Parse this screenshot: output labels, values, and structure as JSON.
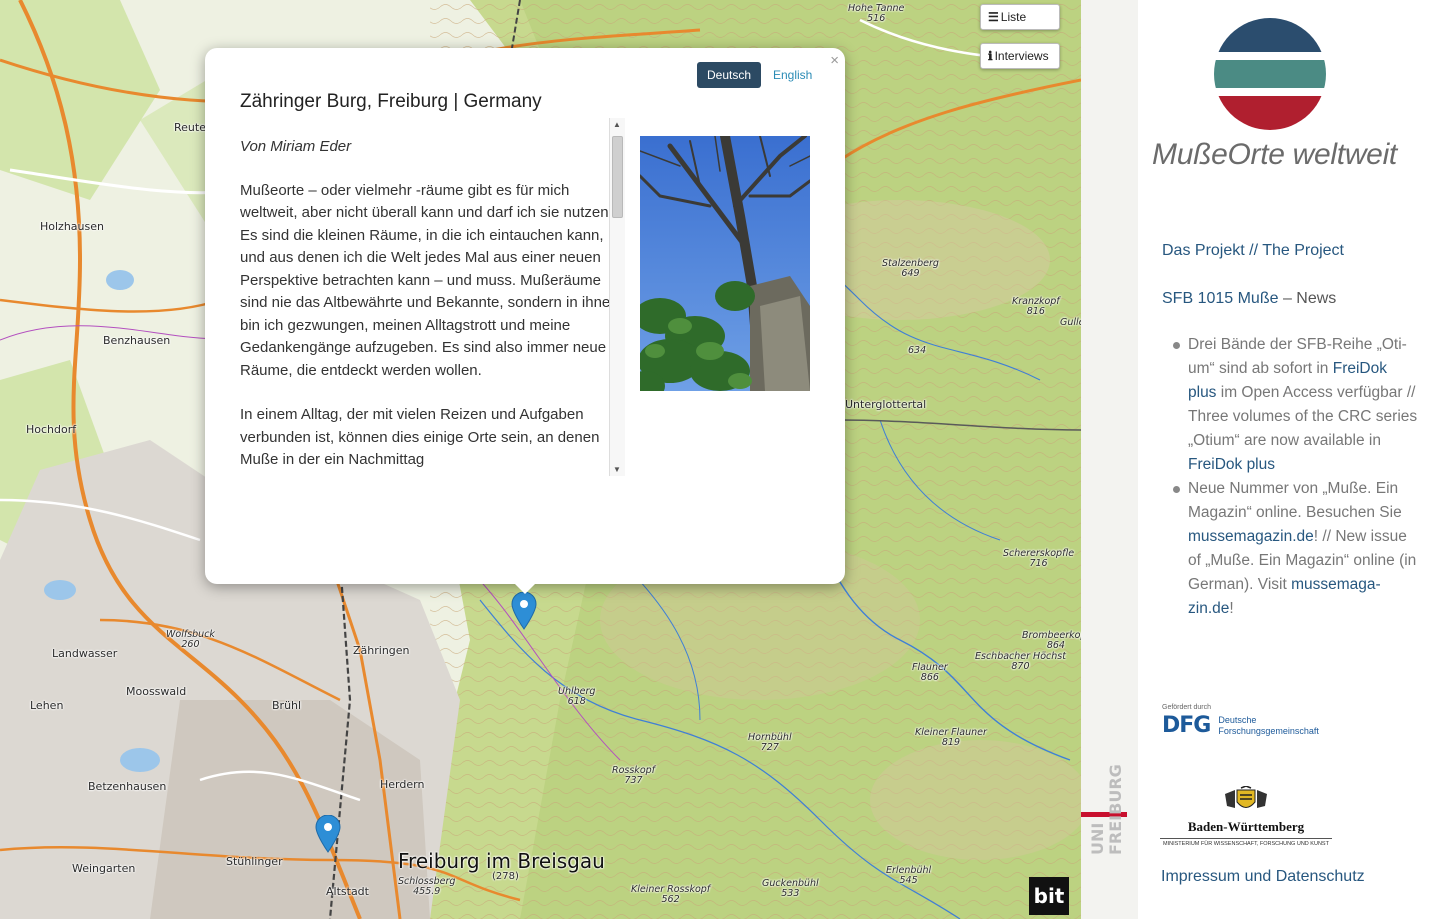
{
  "map": {
    "buttons": {
      "list_label": "Liste",
      "interviews_label": "Interviews",
      "list_icon": "list-icon",
      "interviews_icon": "info-icon"
    },
    "places": {
      "hohe_tanne": "Hohe Tanne",
      "hohe_tanne_alt": "516",
      "reute": "Reute",
      "holzhausen": "Holzhausen",
      "benzhausen": "Benzhausen",
      "hochdorf": "Hochdorf",
      "stalzenberg": "Stalzenberg",
      "stalzenberg_alt": "649",
      "kranzkopf": "Kranzkopf",
      "kranzkopf_alt": "816",
      "gullerkopf": "Gullerkopf",
      "alt_634": "634",
      "unterglottertal": "Unterglottertal",
      "scherer": "Schererskopfle",
      "scherer_alt": "716",
      "brombeerkopf": "Brombeerkopf",
      "brombeerkopf_alt": "864",
      "eschbacher": "Eschbacher Höchst",
      "eschbacher_alt": "870",
      "flauner": "Flauner",
      "flauner_alt": "866",
      "wolfsbuck": "Wolfsbuck",
      "wolfsbuck_alt": "260",
      "landwasser": "Landwasser",
      "mooswald": "Moosswald",
      "lehen": "Lehen",
      "bruhl": "Brühl",
      "zahringen": "Zähringen",
      "uhlberg": "Uhlberg",
      "uhlberg_alt": "618",
      "hornbuhl": "Hornbühl",
      "hornbuhl_alt": "727",
      "kleiner_flauner": "Kleiner Flauner",
      "kleiner_flauner_alt": "819",
      "rosskopf": "Rosskopf",
      "rosskopf_alt": "737",
      "herdern": "Herdern",
      "betzenhausen": "Betzenhausen",
      "stuhlinger": "Stühlinger",
      "weingarten": "Weingarten",
      "altstadt": "Altstadt",
      "freiburg": "Freiburg im Breisgau",
      "freiburg_alt": "(278)",
      "schlossberg": "Schlossberg",
      "schlossberg_alt": "455.9",
      "kleiner_rosskopf": "Kleiner Rosskopf",
      "kleiner_rosskopf_alt": "562",
      "guckenbuhl": "Guckenbühl",
      "guckenbuhl_alt": "533",
      "erlenbuhl": "Erlenbühl",
      "erlenbuhl_alt": "545"
    },
    "uni_label": "UNI FREIBURG",
    "bit_logo": "bit"
  },
  "popup": {
    "title": "Zähringer Burg, Freiburg | Germany",
    "lang_de": "Deutsch",
    "lang_en": "English",
    "close": "×",
    "author": "Von Miriam Eder",
    "paragraphs": [
      "Mußeorte – oder vielmehr -räume gibt es für mich weltweit, aber nicht überall kann und darf ich sie nutzen. Es sind die kleinen Räume, in die ich eintauchen kann, und aus denen ich die Welt jedes Mal aus einer neuen Perspektive betrachten kann – und muss. Mußeräume sind nie das Altbewährte und Bekannte, sondern in ihnen bin ich gezwungen, meinen Alltagstrott und meine Gedankengänge aufzugeben. Es sind also immer neue Räume, die entdeckt werden wollen.",
      "In einem Alltag, der mit vielen Reizen und Aufgaben verbunden ist, können dies einige Orte sein, an denen Muße in der ein Nachmittag"
    ]
  },
  "sidebar": {
    "logo_text": "MußeOrte weltweit",
    "nav_project": "Das Projekt // The Project",
    "nav_sfb": "SFB 1015 Muße",
    "nav_sfb_sep": " – ",
    "nav_news": "News",
    "news": [
      {
        "pre": "Drei Bände der SFB-Reihe „Oti­um“ sind ab sofort in ",
        "link1": "FreiDok plus",
        "mid": " im Open Access verfügbar // Three volumes of the CRC se­ries „Otium“ are now available in ",
        "link2": "FreiDok plus",
        "post": ""
      },
      {
        "pre": "Neue Nummer von „Muße. Ein Magazin“ online. Besuchen Sie ",
        "link1": "mussemagazin.de",
        "mid": "! // New issue of „Muße. Ein Magazin“ online (in German). Visit ",
        "link2": "mussemaga­zin.de",
        "post": "!"
      }
    ],
    "dfg_small": "Gefördert durch",
    "dfg_letters": "DFG",
    "dfg_line1": "Deutsche",
    "dfg_line2": "Forschungsgemeinschaft",
    "bw_title": "Baden-Württemberg",
    "bw_sub": "MINISTERIUM FÜR WISSENSCHAFT, FORSCHUNG UND KUNST",
    "impressum": "Impressum und Datenschutz"
  },
  "colors": {
    "brand_blue": "#27577f",
    "popup_button": "#2c4a63",
    "link_en": "#2a8bb5",
    "marker": "#2d8ed6",
    "logo_top": "#2b4d6e",
    "logo_mid": "#4b8b84",
    "logo_bot": "#b01f2f"
  }
}
